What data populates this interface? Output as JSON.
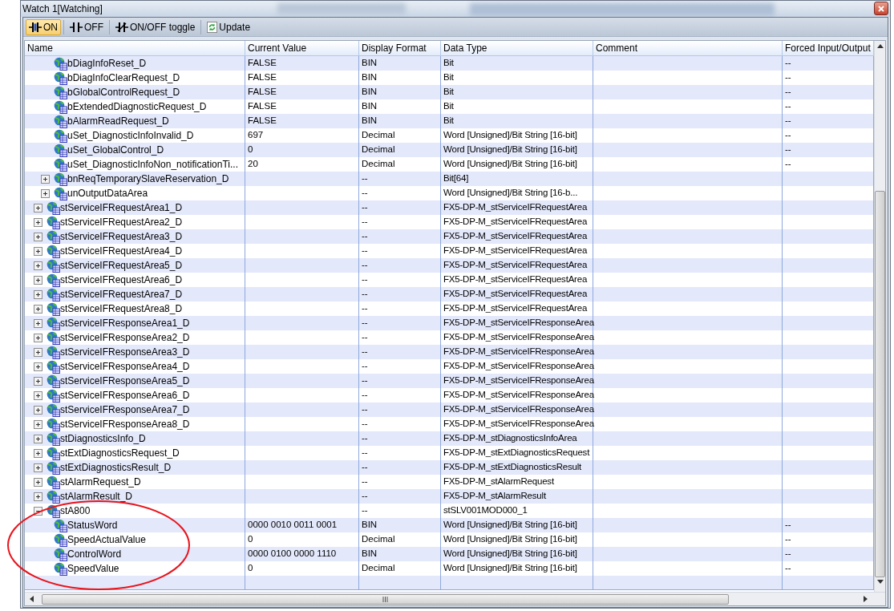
{
  "window": {
    "title": "Watch 1[Watching]"
  },
  "toolbar": [
    {
      "kind": "on",
      "label": "ON",
      "selected": true
    },
    {
      "kind": "off",
      "label": "OFF",
      "selected": false
    },
    {
      "kind": "toggle",
      "label": "ON/OFF toggle",
      "selected": false
    },
    {
      "kind": "update",
      "label": "Update",
      "selected": false
    }
  ],
  "table": {
    "columns": [
      "Name",
      "Current Value",
      "Display Format",
      "Data Type",
      "Comment",
      "Forced Input/Output"
    ],
    "rows": [
      {
        "children": [
          {
            "name": "bDiagInfoReset_D",
            "value": "FALSE",
            "format": "BIN",
            "data_type": "Bit",
            "forced": "--"
          },
          {
            "name": "bDiagInfoClearRequest_D",
            "value": "FALSE",
            "format": "BIN",
            "data_type": "Bit",
            "forced": "--"
          },
          {
            "name": "bGlobalControlRequest_D",
            "value": "FALSE",
            "format": "BIN",
            "data_type": "Bit",
            "forced": "--"
          },
          {
            "name": "bExtendedDiagnosticRequest_D",
            "value": "FALSE",
            "format": "BIN",
            "data_type": "Bit",
            "forced": "--"
          },
          {
            "name": "bAlarmReadRequest_D",
            "value": "FALSE",
            "format": "BIN",
            "data_type": "Bit",
            "forced": "--"
          },
          {
            "name": "uSet_DiagnosticInfoInvalid_D",
            "value": "697",
            "format": "Decimal",
            "data_type": "Word [Unsigned]/Bit String [16-bit]",
            "forced": "--"
          },
          {
            "name": "uSet_GlobalControl_D",
            "value": "0",
            "format": "Decimal",
            "data_type": "Word [Unsigned]/Bit String [16-bit]",
            "forced": "--"
          },
          {
            "name": "uSet_DiagnosticInfoNon_notificationTi...",
            "value": "20",
            "format": "Decimal",
            "data_type": "Word [Unsigned]/Bit String [16-bit]",
            "forced": "--"
          },
          {
            "name": "bnReqTemporarySlaveReservation_D",
            "format": "--",
            "data_type": "Bit[64]",
            "expanded": false
          },
          {
            "name": "unOutputDataArea",
            "format": "--",
            "data_type": "Word [Unsigned]/Bit String [16-b...",
            "expanded": false
          }
        ]
      },
      {
        "name": "stServiceIFRequestArea1_D",
        "format": "--",
        "data_type": "FX5-DP-M_stServiceIFRequestArea",
        "expanded": false
      },
      {
        "name": "stServiceIFRequestArea2_D",
        "format": "--",
        "data_type": "FX5-DP-M_stServiceIFRequestArea",
        "expanded": false
      },
      {
        "name": "stServiceIFRequestArea3_D",
        "format": "--",
        "data_type": "FX5-DP-M_stServiceIFRequestArea",
        "expanded": false
      },
      {
        "name": "stServiceIFRequestArea4_D",
        "format": "--",
        "data_type": "FX5-DP-M_stServiceIFRequestArea",
        "expanded": false
      },
      {
        "name": "stServiceIFRequestArea5_D",
        "format": "--",
        "data_type": "FX5-DP-M_stServiceIFRequestArea",
        "expanded": false
      },
      {
        "name": "stServiceIFRequestArea6_D",
        "format": "--",
        "data_type": "FX5-DP-M_stServiceIFRequestArea",
        "expanded": false
      },
      {
        "name": "stServiceIFRequestArea7_D",
        "format": "--",
        "data_type": "FX5-DP-M_stServiceIFRequestArea",
        "expanded": false
      },
      {
        "name": "stServiceIFRequestArea8_D",
        "format": "--",
        "data_type": "FX5-DP-M_stServiceIFRequestArea",
        "expanded": false
      },
      {
        "name": "stServiceIFResponseArea1_D",
        "format": "--",
        "data_type": "FX5-DP-M_stServiceIFResponseArea",
        "expanded": false
      },
      {
        "name": "stServiceIFResponseArea2_D",
        "format": "--",
        "data_type": "FX5-DP-M_stServiceIFResponseArea",
        "expanded": false
      },
      {
        "name": "stServiceIFResponseArea3_D",
        "format": "--",
        "data_type": "FX5-DP-M_stServiceIFResponseArea",
        "expanded": false
      },
      {
        "name": "stServiceIFResponseArea4_D",
        "format": "--",
        "data_type": "FX5-DP-M_stServiceIFResponseArea",
        "expanded": false
      },
      {
        "name": "stServiceIFResponseArea5_D",
        "format": "--",
        "data_type": "FX5-DP-M_stServiceIFResponseArea",
        "expanded": false
      },
      {
        "name": "stServiceIFResponseArea6_D",
        "format": "--",
        "data_type": "FX5-DP-M_stServiceIFResponseArea",
        "expanded": false
      },
      {
        "name": "stServiceIFResponseArea7_D",
        "format": "--",
        "data_type": "FX5-DP-M_stServiceIFResponseArea",
        "expanded": false
      },
      {
        "name": "stServiceIFResponseArea8_D",
        "format": "--",
        "data_type": "FX5-DP-M_stServiceIFResponseArea",
        "expanded": false
      },
      {
        "name": "stDiagnosticsInfo_D",
        "format": "--",
        "data_type": "FX5-DP-M_stDiagnosticsInfoArea",
        "expanded": false
      },
      {
        "name": "stExtDiagnosticsRequest_D",
        "format": "--",
        "data_type": "FX5-DP-M_stExtDiagnosticsRequest",
        "expanded": false
      },
      {
        "name": "stExtDiagnosticsResult_D",
        "format": "--",
        "data_type": "FX5-DP-M_stExtDiagnosticsResult",
        "expanded": false
      },
      {
        "name": "stAlarmRequest_D",
        "format": "--",
        "data_type": "FX5-DP-M_stAlarmRequest",
        "expanded": false
      },
      {
        "name": "stAlarmResult_D",
        "format": "--",
        "data_type": "FX5-DP-M_stAlarmResult",
        "expanded": false
      },
      {
        "name": "stA800",
        "format": "--",
        "data_type": "stSLV001MOD000_1",
        "expanded": true,
        "children": [
          {
            "name": "StatusWord",
            "value": "0000 0010 0011 0001",
            "format": "BIN",
            "data_type": "Word [Unsigned]/Bit String [16-bit]",
            "forced": "--"
          },
          {
            "name": "SpeedActualValue",
            "value": "0",
            "format": "Decimal",
            "data_type": "Word [Unsigned]/Bit String [16-bit]",
            "forced": "--"
          },
          {
            "name": "ControlWord",
            "value": "0000 0100 0000 1110",
            "format": "BIN",
            "data_type": "Word [Unsigned]/Bit String [16-bit]",
            "forced": "--"
          },
          {
            "name": "SpeedValue",
            "value": "0",
            "format": "Decimal",
            "data_type": "Word [Unsigned]/Bit String [16-bit]",
            "forced": "--"
          }
        ]
      }
    ]
  }
}
